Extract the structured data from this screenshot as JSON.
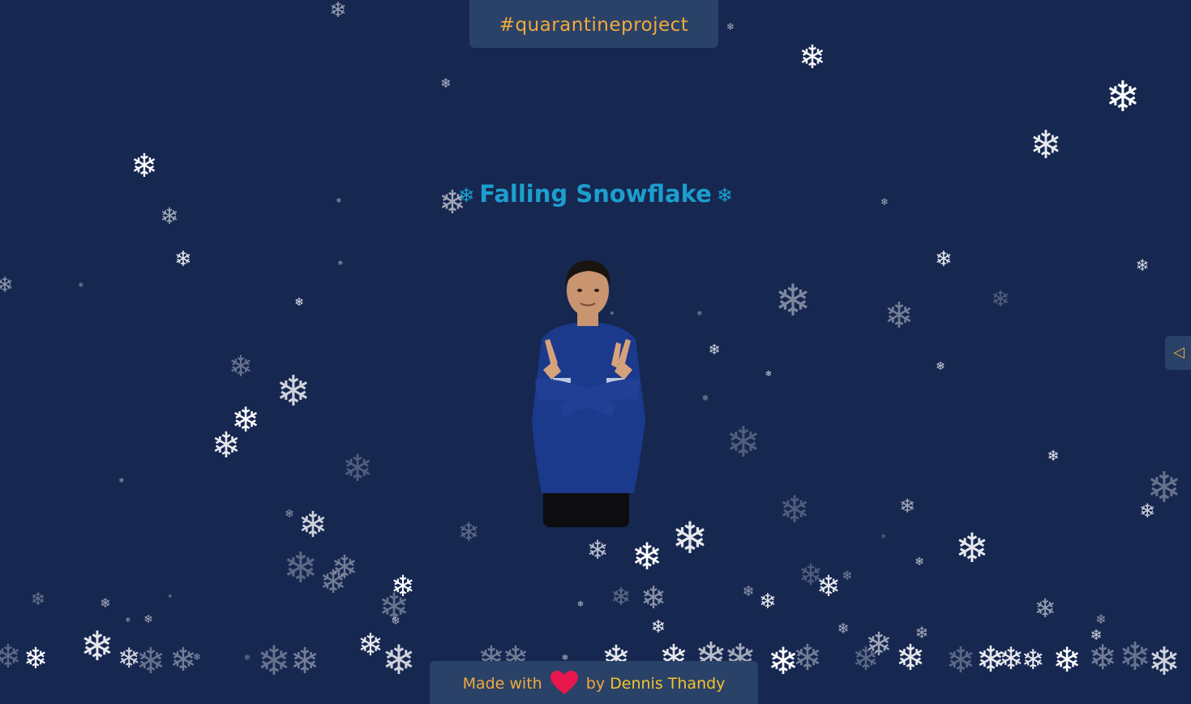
{
  "header": {
    "hashtag": "#quarantineproject"
  },
  "main": {
    "title": "Falling Snowflake",
    "title_decoration": "❄"
  },
  "sidebar_toggle": {
    "icon": "◁"
  },
  "footer": {
    "prefix": "Made with",
    "suffix": "by",
    "author": "Dennis Thandy"
  },
  "colors": {
    "background": "#162750",
    "panel": "#2a4268",
    "accent_orange": "#f2a93b",
    "author_yellow": "#f6c22b",
    "title_blue": "#1c9fce",
    "heart_red": "#e8174d"
  },
  "icons": [
    "snowflake-icon",
    "heart-icon",
    "triangle-left-icon"
  ]
}
